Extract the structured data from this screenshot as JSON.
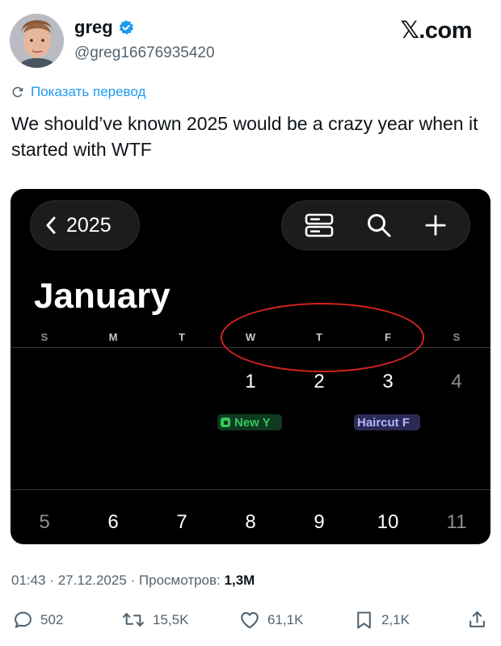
{
  "user": {
    "display_name": "greg",
    "handle": "@greg16676935420",
    "verified": true,
    "avatar_icon": "avatar-photo"
  },
  "brand": {
    "logo_text": "𝕏.com"
  },
  "translate": {
    "label": "Показать перевод",
    "icon": "translate-icon"
  },
  "tweet": {
    "text": "We should’ve known 2025 would be a crazy year when it started with WTF"
  },
  "calendar": {
    "year_button": "2025",
    "month": "January",
    "weekdays": [
      "S",
      "M",
      "T",
      "W",
      "T",
      "F",
      "S"
    ],
    "week1_days": [
      "1",
      "2",
      "3",
      "4"
    ],
    "week2_days": [
      "5",
      "6",
      "7",
      "8",
      "9",
      "10",
      "11"
    ],
    "events": [
      {
        "label": "New Y",
        "color": "#34c759"
      },
      {
        "label": "Haircut F",
        "color": "#b1b4ff"
      }
    ],
    "highlight_color": "#d9241e"
  },
  "meta": {
    "time": "01:43",
    "separator": "·",
    "date": "27.12.2025",
    "views_label": "Просмотров:",
    "views_count": "1,3M"
  },
  "actions": {
    "replies": "502",
    "reposts": "15,5K",
    "likes": "61,1K",
    "bookmarks": "2,1K"
  },
  "colors": {
    "accent": "#1d9bf0",
    "text": "#0f1419",
    "muted": "#536471"
  }
}
